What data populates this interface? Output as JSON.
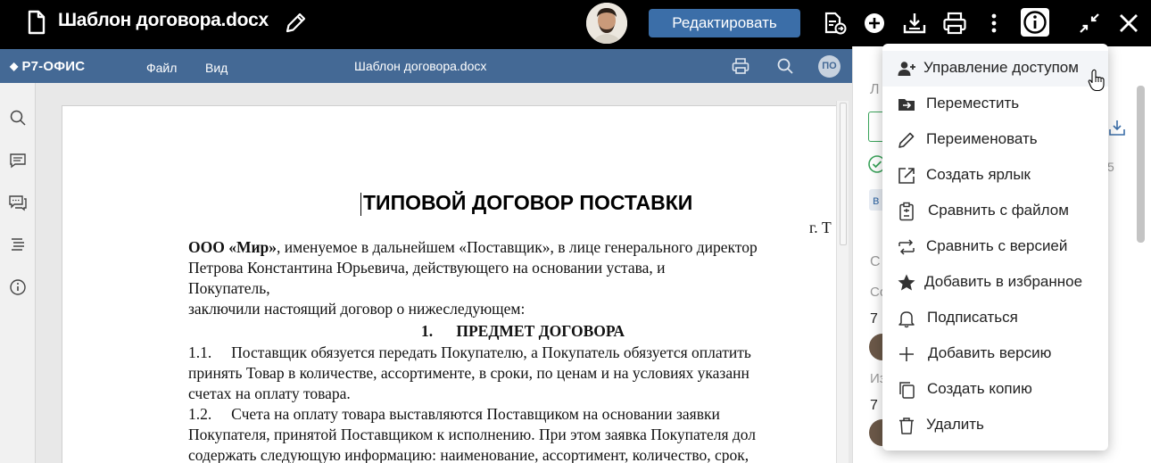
{
  "topbar": {
    "file_title": "Шаблон договора.docx",
    "edit_button": "Редактировать"
  },
  "editor": {
    "logo": "Р7-ОФИС",
    "menu_file": "Файл",
    "menu_view": "Вид",
    "doc_title": "Шаблон договора.docx",
    "user_initials": "ПО"
  },
  "document": {
    "title": "ТИПОВОЙ ДОГОВОР ПОСТАВКИ",
    "city": "г. Т",
    "p1_bold": "ООО «Мир»",
    "p1_rest": ", именуемое в дальнейшем «Поставщик», в лице генерального директор",
    "p2": "Петрова Константина Юрьевича, действующего на основании устава, и",
    "p3": "Покупатель,",
    "p4": "заключили настоящий договор о нижеследующем:",
    "section1": "1.      ПРЕДМЕТ ДОГОВОРА",
    "p5": "1.1.     Поставщик обязуется передать Покупателю, а Покупатель обязуется оплатить",
    "p6": "принять Товар в количестве, ассортименте, в сроки, по ценам и на условиях указанн",
    "p7": "счетах на оплату товара.",
    "p8": "1.2.     Счета на оплату товара выставляются Поставщиком на основании заявки",
    "p9": "Покупателя, принятой Поставщиком к исполнению. При этом заявка Покупателя дол",
    "p10": "содержать следующую информацию: наименование, ассортимент, количество, срок,"
  },
  "panel": {
    "t1": "Л",
    "t2": "в",
    "t3": "5",
    "t4": "С",
    "t5": "Со",
    "t6": "7",
    "t7": "Из",
    "t8": "7"
  },
  "menu": {
    "items": [
      {
        "label": "Управление доступом",
        "icon": "user-plus-icon"
      },
      {
        "label": "Переместить",
        "icon": "folder-move-icon"
      },
      {
        "label": "Переименовать",
        "icon": "pencil-icon"
      },
      {
        "label": "Создать ярлык",
        "icon": "external-link-icon"
      },
      {
        "label": "Сравнить с файлом",
        "icon": "clipboard-compare-icon"
      },
      {
        "label": "Сравнить с версией",
        "icon": "arrows-compare-icon"
      },
      {
        "label": "Добавить в избранное",
        "icon": "star-icon"
      },
      {
        "label": "Подписаться",
        "icon": "bell-icon"
      },
      {
        "label": "Добавить версию",
        "icon": "plus-icon"
      },
      {
        "label": "Создать копию",
        "icon": "copy-icon"
      },
      {
        "label": "Удалить",
        "icon": "trash-icon"
      }
    ]
  },
  "colors": {
    "topbar": "#000000",
    "editor_header": "#446995",
    "edit_button": "#3b6ea8",
    "accent_green": "#3aa35a",
    "accent_blue": "#3b6ea8"
  }
}
